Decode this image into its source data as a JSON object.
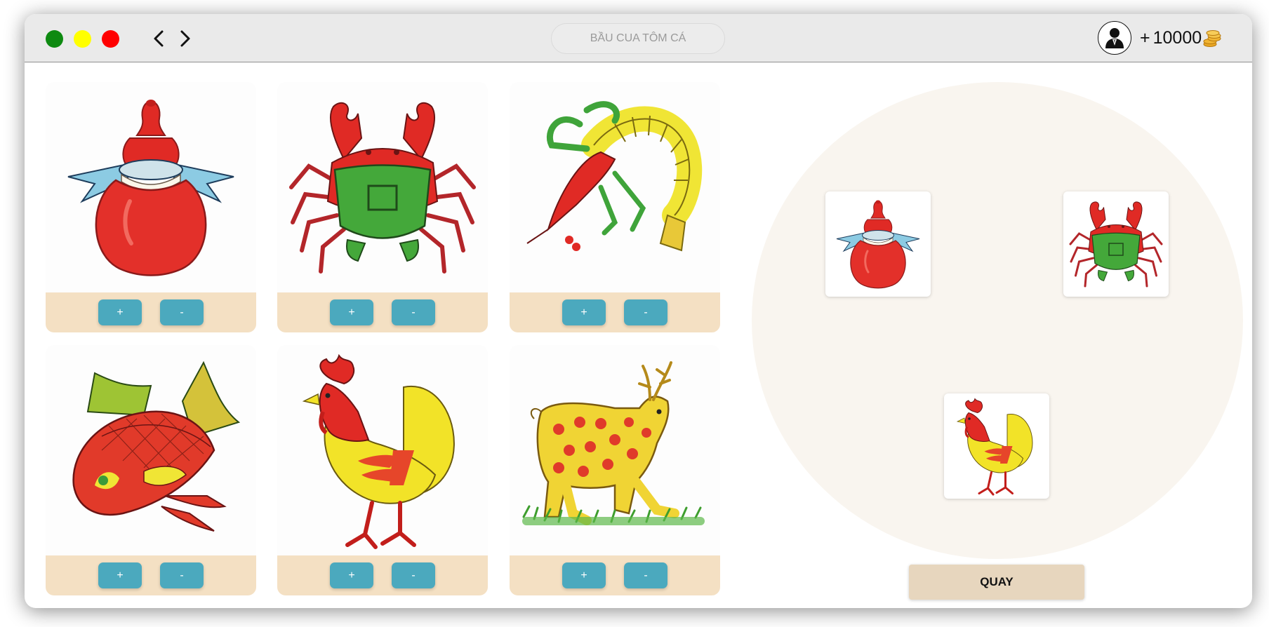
{
  "window": {
    "address_text": "BẦU CUA TÔM CÁ",
    "balance_prefix": "+",
    "balance_value": "10000",
    "balance_icon": "coin-stack-icon",
    "user_icon": "user-avatar-icon"
  },
  "colors": {
    "bet_bar": "#f4e0c3",
    "bet_button": "#4ba9be",
    "plate": "#f9f5ef",
    "spin_button": "#e7d6be"
  },
  "cards": [
    {
      "symbol": "gourd",
      "plus": "+",
      "minus": "-"
    },
    {
      "symbol": "crab",
      "plus": "+",
      "minus": "-"
    },
    {
      "symbol": "shrimp",
      "plus": "+",
      "minus": "-"
    },
    {
      "symbol": "fish",
      "plus": "+",
      "minus": "-"
    },
    {
      "symbol": "rooster",
      "plus": "+",
      "minus": "-"
    },
    {
      "symbol": "deer",
      "plus": "+",
      "minus": "-"
    }
  ],
  "dice_result": [
    "gourd",
    "crab",
    "rooster"
  ],
  "spin_label": "QUAY"
}
